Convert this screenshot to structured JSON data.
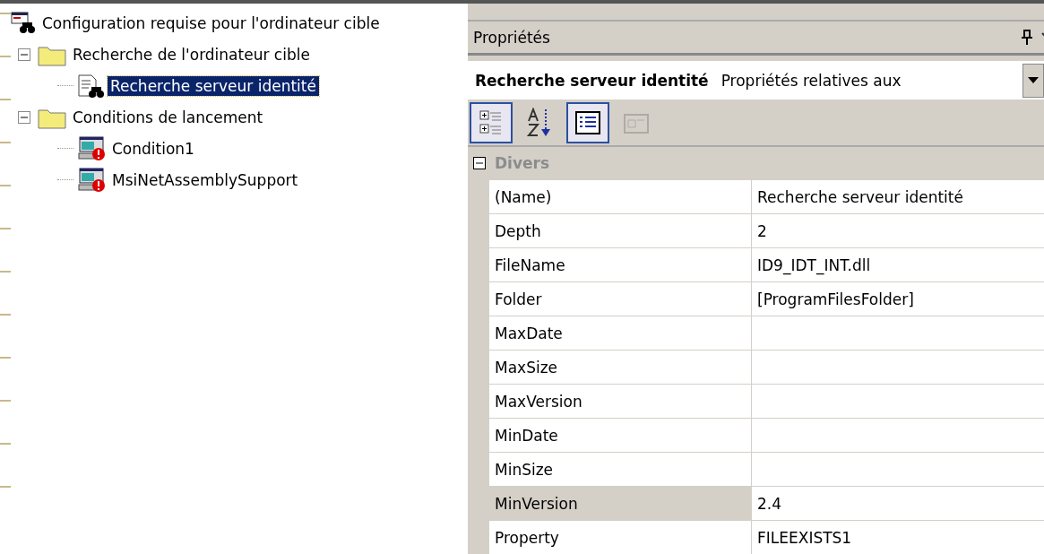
{
  "tree": [
    {
      "label": "Configuration requise pour l'ordinateur cible",
      "kind": "root",
      "selected": false,
      "children": [
        {
          "label": "Recherche de l'ordinateur cible",
          "kind": "folder",
          "selected": false,
          "expanded": true,
          "children": [
            {
              "label": "Recherche serveur identité",
              "kind": "search",
              "selected": true
            }
          ]
        },
        {
          "label": "Conditions de lancement",
          "kind": "folder",
          "selected": false,
          "expanded": true,
          "children": [
            {
              "label": "Condition1",
              "kind": "condition",
              "selected": false
            },
            {
              "label": "MsiNetAssemblySupport",
              "kind": "condition",
              "selected": false
            }
          ]
        }
      ]
    }
  ],
  "properties": {
    "title": "Propriétés",
    "object": {
      "name": "Recherche serveur identité",
      "type": "Propriétés relatives aux"
    },
    "toolbar": [
      {
        "kind": "categorized",
        "selected": true,
        "disabled": false
      },
      {
        "kind": "alphabetical",
        "selected": false,
        "disabled": false
      },
      {
        "kind": "properties",
        "selected": true,
        "disabled": false
      },
      {
        "kind": "pages",
        "selected": false,
        "disabled": true
      }
    ],
    "categories": [
      {
        "label": "Divers",
        "expanded": true,
        "rows": [
          {
            "name": "(Name)",
            "value": "Recherche serveur identité",
            "selected": false
          },
          {
            "name": "Depth",
            "value": "2",
            "selected": false
          },
          {
            "name": "FileName",
            "value": "ID9_IDT_INT.dll",
            "selected": false
          },
          {
            "name": "Folder",
            "value": "[ProgramFilesFolder]",
            "selected": false
          },
          {
            "name": "MaxDate",
            "selected": false
          },
          {
            "name": "MaxSize",
            "selected": false
          },
          {
            "name": "MaxVersion",
            "selected": false
          },
          {
            "name": "MinDate",
            "selected": false
          },
          {
            "name": "MinSize",
            "selected": false
          },
          {
            "name": "MinVersion",
            "value": "2.4",
            "selected": true
          },
          {
            "name": "Property",
            "value": "FILEEXISTS1",
            "selected": false
          }
        ]
      }
    ]
  }
}
